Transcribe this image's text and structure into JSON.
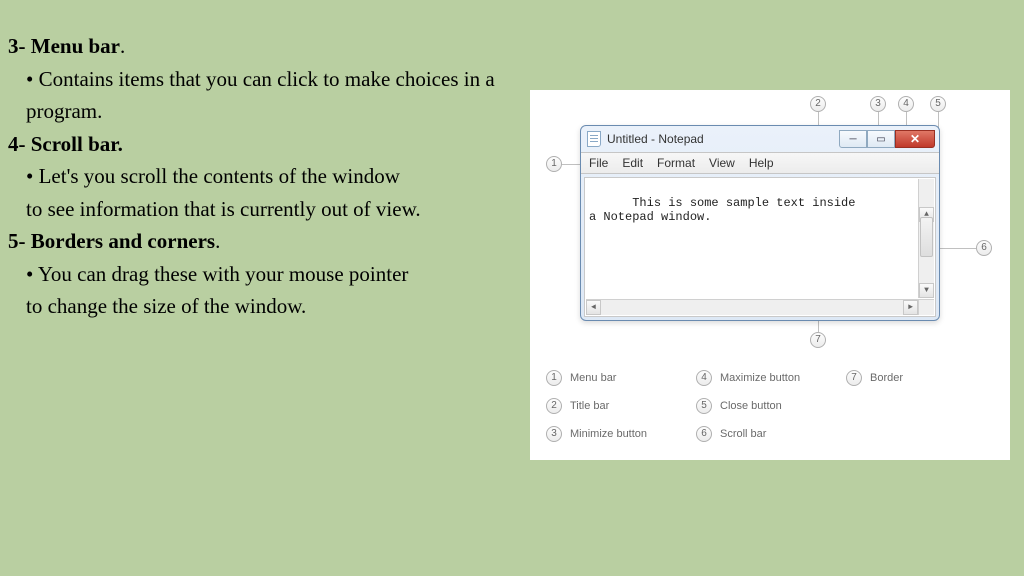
{
  "text": {
    "h3": "3- Menu bar",
    "h3_dot": ".",
    "p3": "• Contains items that you can click to make choices in a program.",
    "h4": "4- Scroll bar.",
    "p4a": "•  Let's you scroll the contents of the window",
    "p4b": "to see information that is currently out of view.",
    "h5": "5- Borders and corners",
    "h5_dot": ".",
    "p5a": "• You can drag these with your mouse pointer",
    "p5b": "to change the size of the window."
  },
  "notepad": {
    "title": "Untitled - Notepad",
    "menu": [
      "File",
      "Edit",
      "Format",
      "View",
      "Help"
    ],
    "body": "This is some sample text inside\na Notepad window."
  },
  "callouts": {
    "c1": "1",
    "c2": "2",
    "c3": "3",
    "c4": "4",
    "c5": "5",
    "c6": "6",
    "c7": "7"
  },
  "legend": [
    {
      "n": "1",
      "label": "Menu bar"
    },
    {
      "n": "2",
      "label": "Title bar"
    },
    {
      "n": "3",
      "label": "Minimize button"
    },
    {
      "n": "4",
      "label": "Maximize button"
    },
    {
      "n": "5",
      "label": "Close button"
    },
    {
      "n": "6",
      "label": "Scroll bar"
    },
    {
      "n": "7",
      "label": "Border"
    }
  ]
}
